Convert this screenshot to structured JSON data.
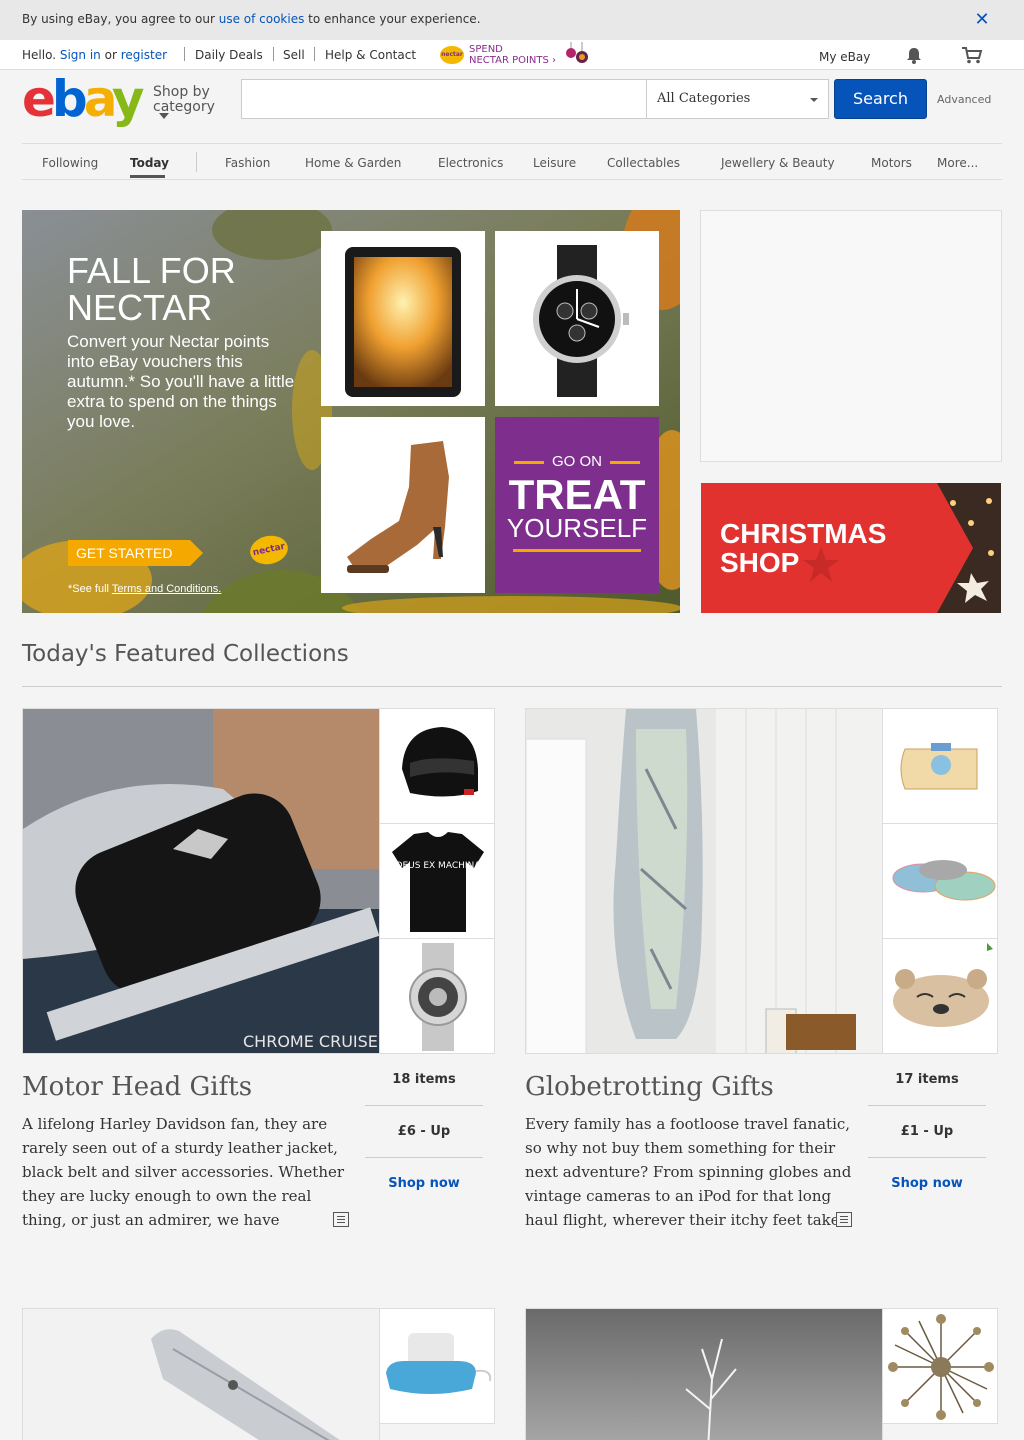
{
  "cookie": {
    "prefix": "By using eBay, you agree to our ",
    "link": "use of cookies",
    "suffix": " to enhance your experience.",
    "close_label": "✕"
  },
  "topnav": {
    "hello": "Hello.",
    "sign_in": "Sign in",
    "or": "or",
    "register": "register",
    "daily_deals": "Daily Deals",
    "sell": "Sell",
    "help": "Help & Contact",
    "nectar_logo": "nectar",
    "nectar_line1": "SPEND",
    "nectar_line2": "NECTAR POINTS ›",
    "my_ebay": "My eBay"
  },
  "header": {
    "logo": {
      "e": "e",
      "b": "b",
      "a": "a",
      "y": "y"
    },
    "shop_by_line1": "Shop by",
    "shop_by_line2": "category",
    "search_placeholder": "",
    "category_selected": "All Categories",
    "search_button": "Search",
    "advanced": "Advanced"
  },
  "catnav": {
    "items": [
      "Following",
      "Today",
      "Fashion",
      "Home & Garden",
      "Electronics",
      "Leisure",
      "Collectables",
      "Jewellery & Beauty",
      "Motors",
      "More..."
    ],
    "active": "Today"
  },
  "hero": {
    "title_line1": "FALL FOR",
    "title_line2": "NECTAR",
    "subtitle": "Convert your Nectar points into eBay vouchers this autumn.* So you'll have a little extra to spend on the things you love.",
    "cta": "GET STARTED",
    "nectar_badge": "nectar",
    "terms_prefix": "*See full ",
    "terms_link": "Terms and Conditions.",
    "tile_go_on": "GO ON",
    "tile_treat": "TREAT",
    "tile_yourself": "YOURSELF"
  },
  "side_banner": {
    "line1": "CHRISTMAS",
    "line2": "SHOP"
  },
  "featured": {
    "title": "Today's Featured Collections",
    "collections": [
      {
        "name": "Motor Head Gifts",
        "description": "A lifelong Harley Davidson fan, they are rarely seen out of a sturdy leather jacket, black belt and silver accessories. Whether they are lucky enough to own the real thing, or just an admirer, we have Christmas gifts",
        "items": "18 items",
        "price": "£6 - Up",
        "shop": "Shop now",
        "watermark": "CHROME CRUISERS",
        "shirt_text": "DEUS EX MACHINA"
      },
      {
        "name": "Globetrotting Gifts",
        "description": "Every family has a footloose travel fanatic, so why not buy them something for their next adventure? From spinning globes and vintage cameras to an iPod for that long haul flight, wherever their itchy feet take them, they'll",
        "items": "17 items",
        "price": "£1 - Up",
        "shop": "Shop now"
      }
    ]
  },
  "colors": {
    "link": "#0654ba",
    "search_button": "#0654ba",
    "nectar_purple": "#7e2f8e",
    "nectar_orange": "#f5a800",
    "christmas_red": "#e2322f"
  }
}
